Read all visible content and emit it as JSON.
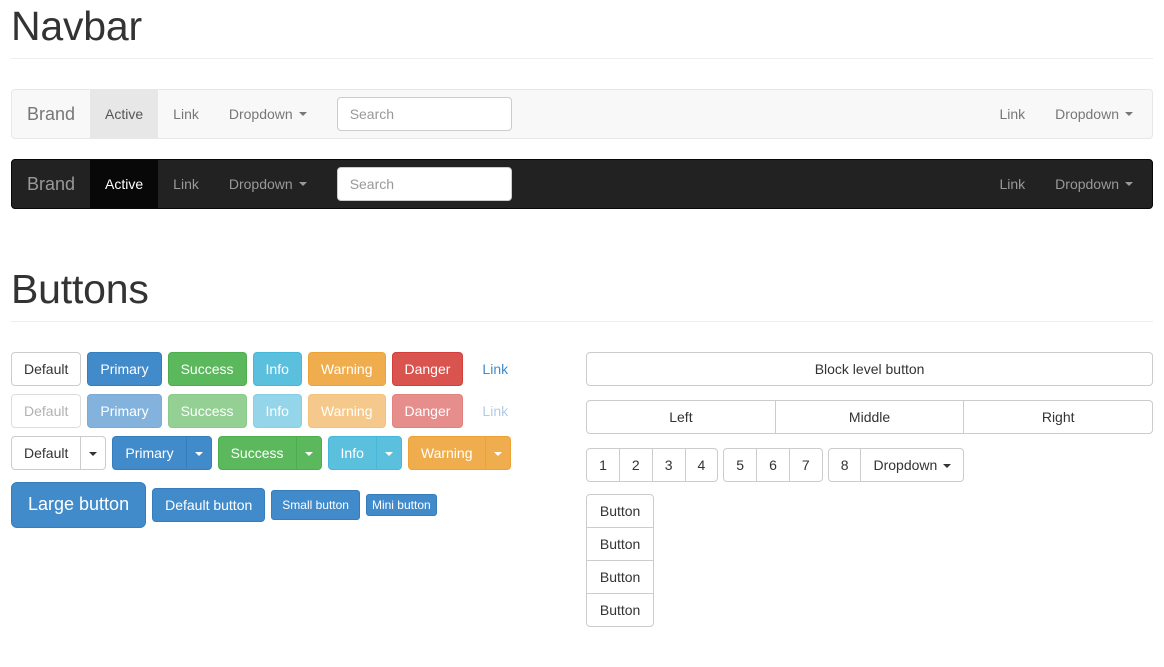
{
  "sections": {
    "navbar_heading": "Navbar",
    "buttons_heading": "Buttons"
  },
  "navbars": [
    {
      "variant": "default",
      "brand": "Brand",
      "left_items": [
        {
          "label": "Active",
          "active": true,
          "caret": false
        },
        {
          "label": "Link",
          "active": false,
          "caret": false
        },
        {
          "label": "Dropdown",
          "active": false,
          "caret": true
        }
      ],
      "search_placeholder": "Search",
      "search_value": "",
      "right_items": [
        {
          "label": "Link",
          "active": false,
          "caret": false
        },
        {
          "label": "Dropdown",
          "active": false,
          "caret": true
        }
      ]
    },
    {
      "variant": "inverse",
      "brand": "Brand",
      "left_items": [
        {
          "label": "Active",
          "active": true,
          "caret": false
        },
        {
          "label": "Link",
          "active": false,
          "caret": false
        },
        {
          "label": "Dropdown",
          "active": false,
          "caret": true
        }
      ],
      "search_placeholder": "Search",
      "search_value": "",
      "right_items": [
        {
          "label": "Link",
          "active": false,
          "caret": false
        },
        {
          "label": "Dropdown",
          "active": false,
          "caret": true
        }
      ]
    }
  ],
  "buttons": {
    "row_enabled": [
      {
        "label": "Default",
        "style": "default"
      },
      {
        "label": "Primary",
        "style": "primary"
      },
      {
        "label": "Success",
        "style": "success"
      },
      {
        "label": "Info",
        "style": "info"
      },
      {
        "label": "Warning",
        "style": "warning"
      },
      {
        "label": "Danger",
        "style": "danger"
      },
      {
        "label": "Link",
        "style": "link"
      }
    ],
    "row_disabled": [
      {
        "label": "Default",
        "style": "default"
      },
      {
        "label": "Primary",
        "style": "primary"
      },
      {
        "label": "Success",
        "style": "success"
      },
      {
        "label": "Info",
        "style": "info"
      },
      {
        "label": "Warning",
        "style": "warning"
      },
      {
        "label": "Danger",
        "style": "danger"
      },
      {
        "label": "Link",
        "style": "link"
      }
    ],
    "row_split_dropdowns": [
      {
        "label": "Default",
        "style": "default"
      },
      {
        "label": "Primary",
        "style": "primary"
      },
      {
        "label": "Success",
        "style": "success"
      },
      {
        "label": "Info",
        "style": "info"
      },
      {
        "label": "Warning",
        "style": "warning"
      }
    ],
    "row_sizes": [
      {
        "label": "Large button",
        "size": "lg"
      },
      {
        "label": "Default button",
        "size": "md"
      },
      {
        "label": "Small button",
        "size": "sm"
      },
      {
        "label": "Mini button",
        "size": "xs"
      }
    ]
  },
  "right_column": {
    "block_button": "Block level button",
    "justified_group": [
      "Left",
      "Middle",
      "Right"
    ],
    "toolbar": {
      "group_a": [
        "1",
        "2",
        "3",
        "4"
      ],
      "group_b": [
        "5",
        "6",
        "7"
      ],
      "group_c": [
        "8"
      ],
      "dropdown_label": "Dropdown"
    },
    "vertical_group": [
      "Button",
      "Button",
      "Button",
      "Button"
    ]
  },
  "colors": {
    "primary": "#428bca",
    "success": "#5cb85c",
    "info": "#5bc0de",
    "warning": "#f0ad4e",
    "danger": "#d9534f",
    "link": "#428bca",
    "navbar_default_bg": "#f8f8f8",
    "navbar_inverse_bg": "#222222",
    "navbar_inverse_active_bg": "#080808",
    "navbar_default_active_bg": "#e7e7e7"
  }
}
